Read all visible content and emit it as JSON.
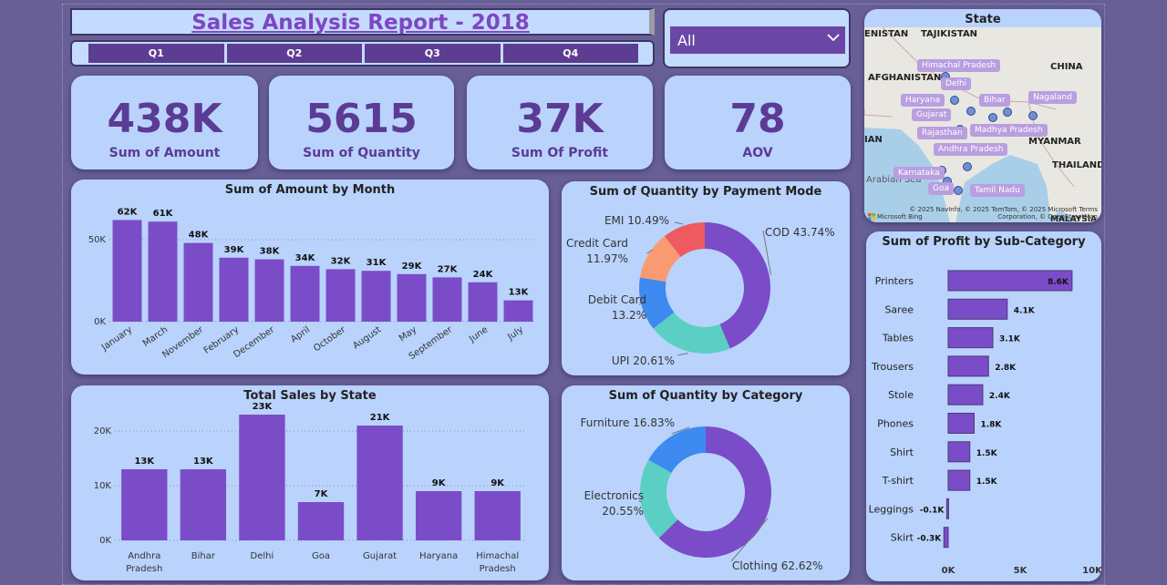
{
  "report": {
    "title": "Sales Analysis Report - 2018"
  },
  "quarters": [
    "Q1",
    "Q2",
    "Q3",
    "Q4"
  ],
  "slicer": {
    "value": "All"
  },
  "kpis": [
    {
      "value": "438K",
      "label": "Sum of Amount"
    },
    {
      "value": "5615",
      "label": "Sum of Quantity"
    },
    {
      "value": "37K",
      "label": "Sum Of Profit"
    },
    {
      "value": "78",
      "label": "AOV"
    }
  ],
  "map": {
    "title": "State",
    "places": [
      "TAJIKISTAN",
      "CHINA",
      "AFGHANISTAN",
      "MYANMAR",
      "THAILAND",
      "MALAYSIA",
      "Arabian Sea",
      "ENISTAN",
      "IAN"
    ],
    "states": [
      "Himachal Pradesh",
      "Delhi",
      "Haryana",
      "Bihar",
      "Nagaland",
      "Gujarat",
      "Madhya Pradesh",
      "Rajasthan",
      "Andhra Pradesh",
      "Karnataka",
      "Goa",
      "Tamil Nadu"
    ],
    "credit_line1": "© 2025 NavInfo, © 2025 TomTom, © 2025 Microsoft   Terms",
    "credit_line2": "Corporation, © OpenStreetMap",
    "bing": "Microsoft Bing"
  },
  "chart_data": [
    {
      "id": "amount_by_month",
      "type": "bar",
      "title": "Sum of Amount by Month",
      "categories": [
        "January",
        "March",
        "November",
        "February",
        "December",
        "April",
        "October",
        "August",
        "May",
        "September",
        "June",
        "July"
      ],
      "values": [
        62,
        61,
        48,
        39,
        38,
        34,
        32,
        31,
        29,
        27,
        24,
        13
      ],
      "labels": [
        "62K",
        "61K",
        "48K",
        "39K",
        "38K",
        "34K",
        "32K",
        "31K",
        "29K",
        "27K",
        "24K",
        "13K"
      ],
      "yticks": [
        "0K",
        "50K"
      ],
      "ylim": [
        0,
        70
      ],
      "grid": true,
      "color": "#7b4cc8"
    },
    {
      "id": "quantity_by_payment",
      "type": "pie",
      "title": "Sum of Quantity by Payment Mode",
      "slices": [
        {
          "label": "COD",
          "value": 43.74,
          "display": "COD 43.74%",
          "color": "#7b4cc8"
        },
        {
          "label": "UPI",
          "value": 20.61,
          "display": "UPI 20.61%",
          "color": "#5ccfc4"
        },
        {
          "label": "Debit Card",
          "value": 13.2,
          "display": "Debit Card|13.2%",
          "color": "#3d8af0"
        },
        {
          "label": "Credit Card",
          "value": 11.97,
          "display": "Credit Card|11.97%",
          "color": "#fa9a72"
        },
        {
          "label": "EMI",
          "value": 10.49,
          "display": "EMI 10.49%",
          "color": "#ee5a5f"
        }
      ]
    },
    {
      "id": "sales_by_state",
      "type": "bar",
      "title": "Total Sales by State",
      "categories": [
        "Andhra Pradesh",
        "Bihar",
        "Delhi",
        "Goa",
        "Gujarat",
        "Haryana",
        "Himachal Pradesh"
      ],
      "values": [
        13,
        13,
        23,
        7,
        21,
        9,
        9
      ],
      "labels": [
        "13K",
        "13K",
        "23K",
        "7K",
        "21K",
        "9K",
        "9K"
      ],
      "yticks": [
        "0K",
        "10K",
        "20K"
      ],
      "ylim": [
        0,
        25
      ],
      "grid": true,
      "color": "#7b4cc8"
    },
    {
      "id": "quantity_by_category",
      "type": "pie",
      "title": "Sum of Quantity by Category",
      "slices": [
        {
          "label": "Clothing",
          "value": 62.62,
          "display": "Clothing 62.62%",
          "color": "#7b4cc8"
        },
        {
          "label": "Electronics",
          "value": 20.55,
          "display": "Electronics|20.55%",
          "color": "#5ccfc4"
        },
        {
          "label": "Furniture",
          "value": 16.83,
          "display": "Furniture 16.83%",
          "color": "#3d8af0"
        }
      ]
    },
    {
      "id": "profit_by_subcategory",
      "type": "bar",
      "orientation": "horizontal",
      "title": "Sum of Profit by Sub-Category",
      "categories": [
        "Printers",
        "Saree",
        "Tables",
        "Trousers",
        "Stole",
        "Phones",
        "Shirt",
        "T-shirt",
        "Leggings",
        "Skirt"
      ],
      "values": [
        8.6,
        4.1,
        3.1,
        2.8,
        2.4,
        1.8,
        1.5,
        1.5,
        -0.1,
        -0.3
      ],
      "labels": [
        "8.6K",
        "4.1K",
        "3.1K",
        "2.8K",
        "2.4K",
        "1.8K",
        "1.5K",
        "1.5K",
        "-0.1K",
        "-0.3K"
      ],
      "xticks": [
        "0K",
        "5K",
        "10K"
      ],
      "xlim": [
        0,
        10
      ],
      "color": "#7b4cc8"
    }
  ]
}
